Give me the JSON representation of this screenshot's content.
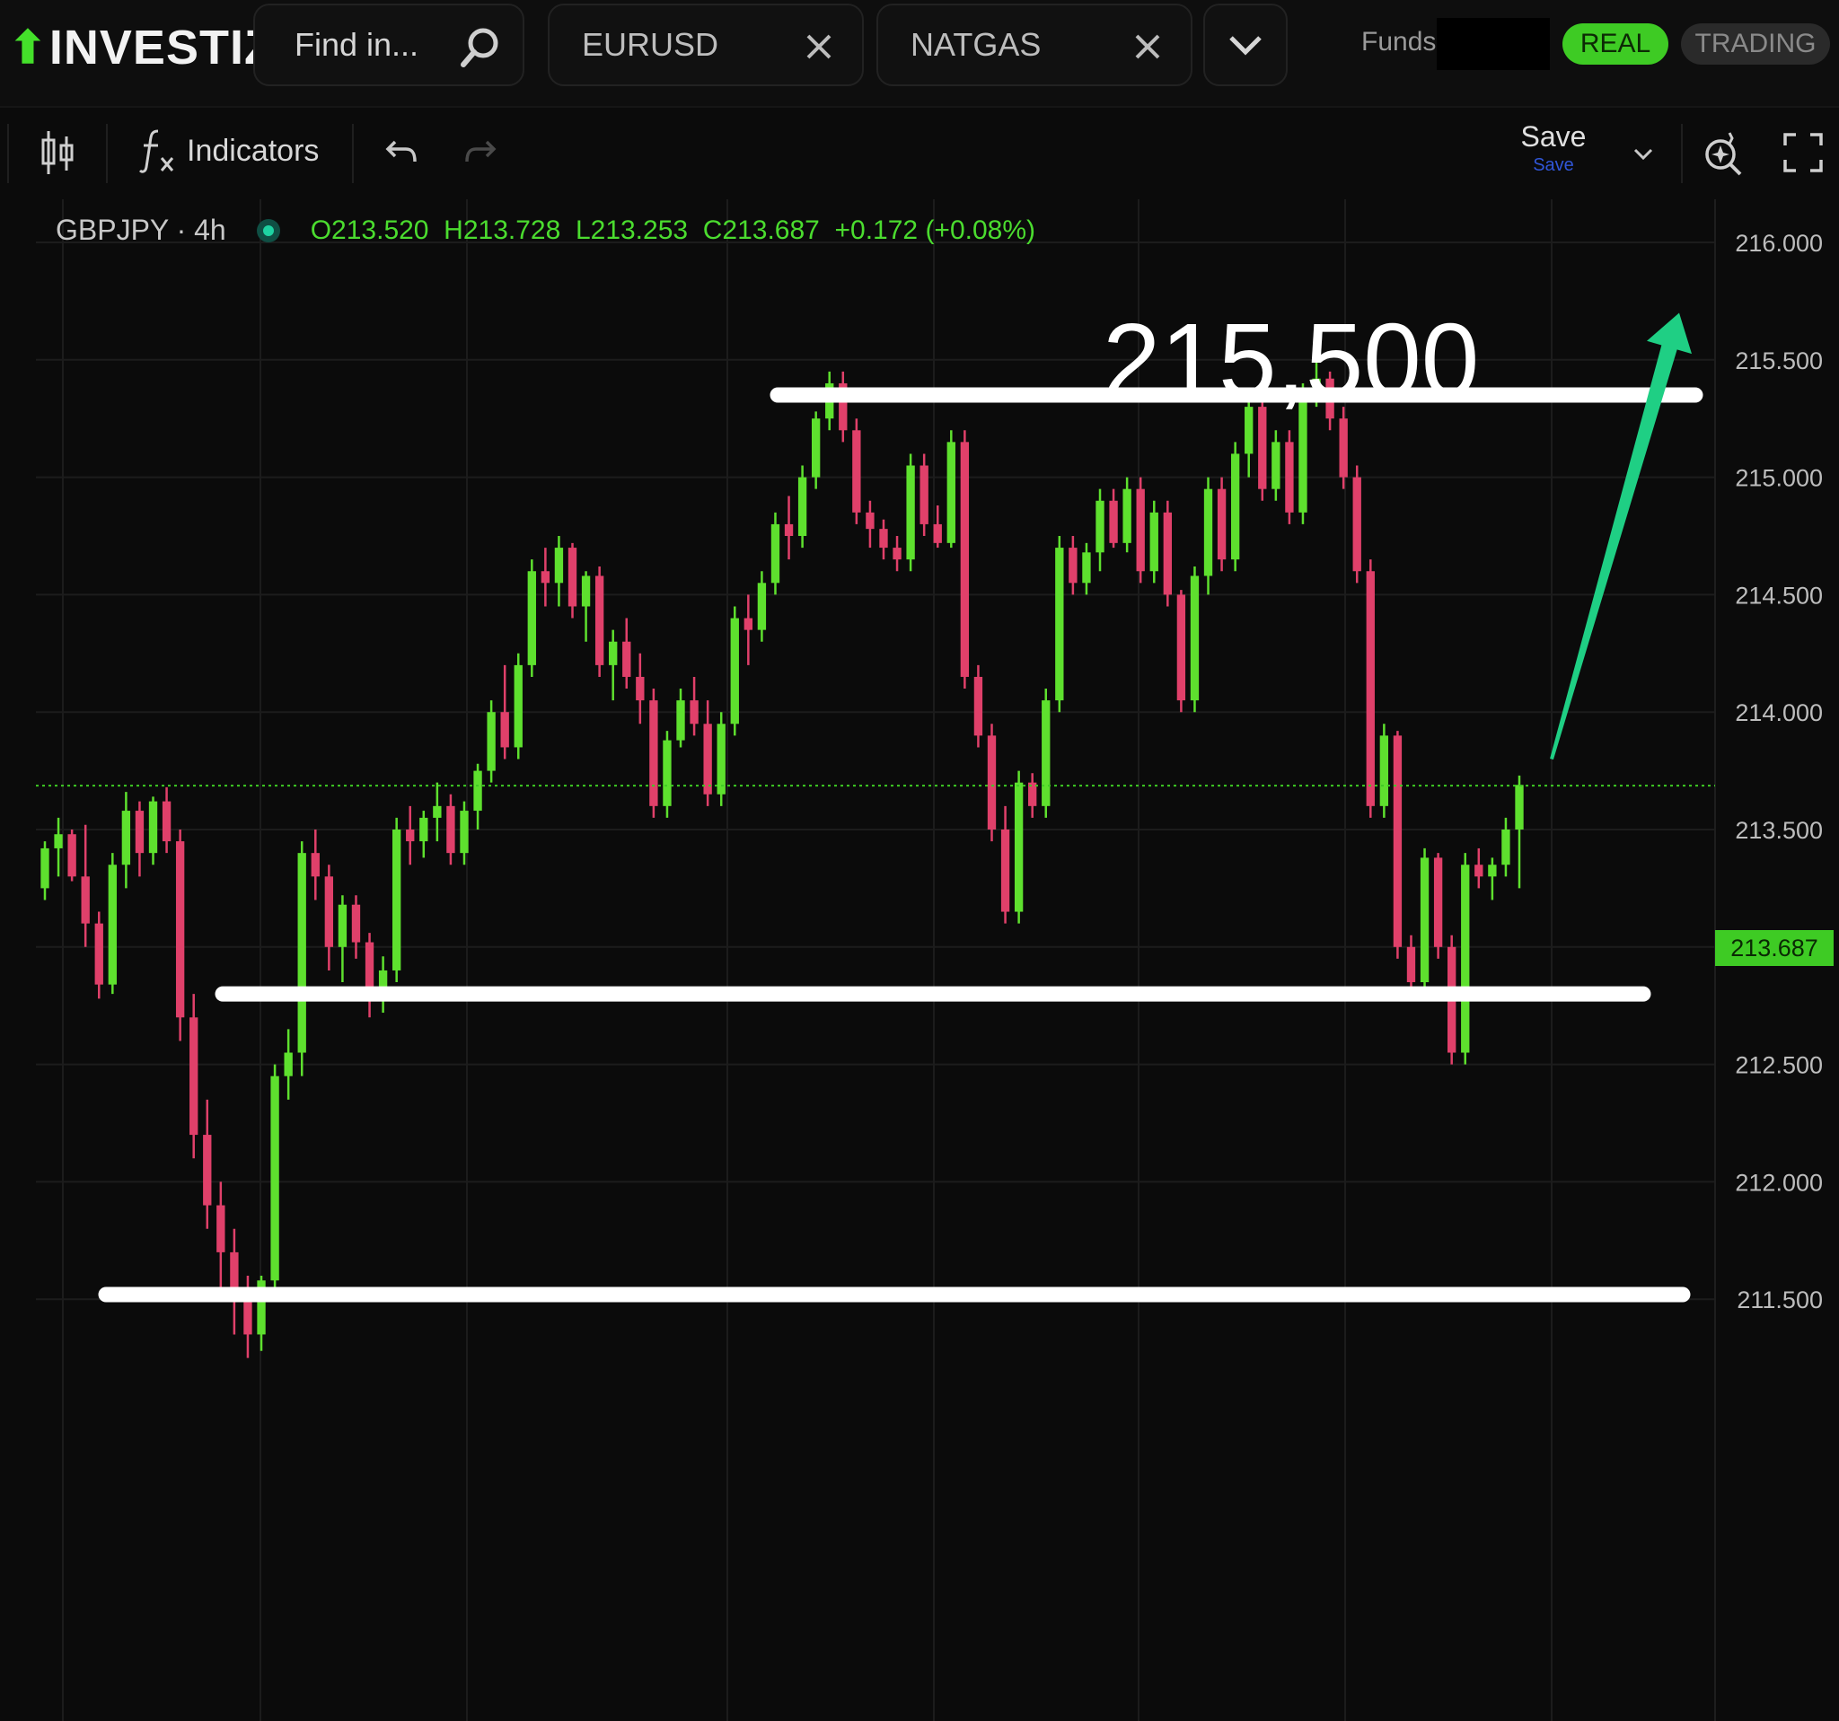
{
  "app": {
    "logo_text": "INVESTIZO"
  },
  "header": {
    "search_placeholder": "Find in...",
    "tabs": [
      {
        "label": "EURUSD"
      },
      {
        "label": "NATGAS"
      }
    ],
    "funds_label": "Funds:",
    "real_label": "REAL",
    "trading_label": "TRADING"
  },
  "toolbar": {
    "indicators_label": "Indicators",
    "save_label": "Save",
    "save_sublabel": "Save"
  },
  "chart_data": {
    "type": "candlestick",
    "symbol": "GBPJPY",
    "interval": "4h",
    "symbol_line": "GBPJPY · 4h",
    "ohlc_text": "O213.520  H213.728  L213.253  C213.687  +0.172 (+0.08%)",
    "last_price": 213.687,
    "last_price_label": "213.687",
    "ylim": [
      211.2,
      216.15
    ],
    "y_ticks": [
      216.0,
      215.5,
      215.0,
      214.5,
      214.0,
      213.5,
      213.0,
      212.5,
      212.0,
      211.5
    ],
    "y_tick_labels": [
      "216.000",
      "215.500",
      "215.000",
      "214.500",
      "214.000",
      "213.500",
      "213.000",
      "212.500",
      "212.000",
      "211.500"
    ],
    "annotation_text": "215,500",
    "horizontal_lines": [
      215.35,
      212.8,
      211.52
    ],
    "arrow": {
      "from_price": 213.8,
      "to_price": 215.7
    },
    "colors": {
      "up": "#5ee02e",
      "down": "#e0406a",
      "background": "#0b0b0b",
      "grid": "#1c1c1c",
      "arrow": "#1fcf84"
    },
    "candles": [
      [
        213.25,
        213.45,
        213.2,
        213.42
      ],
      [
        213.42,
        213.55,
        213.3,
        213.48
      ],
      [
        213.48,
        213.5,
        213.28,
        213.3
      ],
      [
        213.3,
        213.52,
        213.0,
        213.1
      ],
      [
        213.1,
        213.15,
        212.78,
        212.84
      ],
      [
        212.84,
        213.4,
        212.8,
        213.35
      ],
      [
        213.35,
        213.66,
        213.25,
        213.58
      ],
      [
        213.58,
        213.62,
        213.3,
        213.4
      ],
      [
        213.4,
        213.64,
        213.35,
        213.62
      ],
      [
        213.62,
        213.68,
        213.4,
        213.45
      ],
      [
        213.45,
        213.5,
        212.6,
        212.7
      ],
      [
        212.7,
        212.8,
        212.1,
        212.2
      ],
      [
        212.2,
        212.35,
        211.8,
        211.9
      ],
      [
        211.9,
        212.0,
        211.55,
        211.7
      ],
      [
        211.7,
        211.8,
        211.35,
        211.52
      ],
      [
        211.52,
        211.6,
        211.25,
        211.35
      ],
      [
        211.35,
        211.6,
        211.28,
        211.58
      ],
      [
        211.58,
        212.5,
        211.5,
        212.45
      ],
      [
        212.45,
        212.65,
        212.35,
        212.55
      ],
      [
        212.55,
        213.45,
        212.45,
        213.4
      ],
      [
        213.4,
        213.5,
        213.2,
        213.3
      ],
      [
        213.3,
        213.35,
        212.9,
        213.0
      ],
      [
        213.0,
        213.22,
        212.85,
        213.18
      ],
      [
        213.18,
        213.22,
        212.95,
        213.02
      ],
      [
        213.02,
        213.06,
        212.7,
        212.82
      ],
      [
        212.82,
        212.96,
        212.72,
        212.9
      ],
      [
        212.9,
        213.55,
        212.85,
        213.5
      ],
      [
        213.5,
        213.6,
        213.35,
        213.45
      ],
      [
        213.45,
        213.58,
        213.38,
        213.55
      ],
      [
        213.55,
        213.7,
        213.45,
        213.6
      ],
      [
        213.6,
        213.65,
        213.35,
        213.4
      ],
      [
        213.4,
        213.62,
        213.35,
        213.58
      ],
      [
        213.58,
        213.78,
        213.5,
        213.75
      ],
      [
        213.75,
        214.05,
        213.7,
        214.0
      ],
      [
        214.0,
        214.2,
        213.8,
        213.85
      ],
      [
        213.85,
        214.25,
        213.8,
        214.2
      ],
      [
        214.2,
        214.65,
        214.15,
        214.6
      ],
      [
        214.6,
        214.7,
        214.45,
        214.55
      ],
      [
        214.55,
        214.75,
        214.45,
        214.7
      ],
      [
        214.7,
        214.72,
        214.4,
        214.45
      ],
      [
        214.45,
        214.6,
        214.3,
        214.58
      ],
      [
        214.58,
        214.62,
        214.15,
        214.2
      ],
      [
        214.2,
        214.35,
        214.05,
        214.3
      ],
      [
        214.3,
        214.4,
        214.1,
        214.15
      ],
      [
        214.15,
        214.25,
        213.95,
        214.05
      ],
      [
        214.05,
        214.1,
        213.55,
        213.6
      ],
      [
        213.6,
        213.92,
        213.55,
        213.88
      ],
      [
        213.88,
        214.1,
        213.85,
        214.05
      ],
      [
        214.05,
        214.15,
        213.9,
        213.95
      ],
      [
        213.95,
        214.05,
        213.6,
        213.65
      ],
      [
        213.65,
        214.0,
        213.6,
        213.95
      ],
      [
        213.95,
        214.45,
        213.9,
        214.4
      ],
      [
        214.4,
        214.5,
        214.2,
        214.35
      ],
      [
        214.35,
        214.6,
        214.3,
        214.55
      ],
      [
        214.55,
        214.85,
        214.5,
        214.8
      ],
      [
        214.8,
        214.92,
        214.65,
        214.75
      ],
      [
        214.75,
        215.05,
        214.7,
        215.0
      ],
      [
        215.0,
        215.28,
        214.95,
        215.25
      ],
      [
        215.25,
        215.45,
        215.2,
        215.4
      ],
      [
        215.4,
        215.45,
        215.15,
        215.2
      ],
      [
        215.2,
        215.25,
        214.8,
        214.85
      ],
      [
        214.85,
        214.9,
        214.7,
        214.78
      ],
      [
        214.78,
        214.82,
        214.65,
        214.7
      ],
      [
        214.7,
        214.75,
        214.6,
        214.65
      ],
      [
        214.65,
        215.1,
        214.6,
        215.05
      ],
      [
        215.05,
        215.1,
        214.75,
        214.8
      ],
      [
        214.8,
        214.88,
        214.7,
        214.72
      ],
      [
        214.72,
        215.2,
        214.7,
        215.15
      ],
      [
        215.15,
        215.2,
        214.1,
        214.15
      ],
      [
        214.15,
        214.2,
        213.85,
        213.9
      ],
      [
        213.9,
        213.95,
        213.45,
        213.5
      ],
      [
        213.5,
        213.6,
        213.1,
        213.15
      ],
      [
        213.15,
        213.75,
        213.1,
        213.7
      ],
      [
        213.7,
        213.74,
        213.55,
        213.6
      ],
      [
        213.6,
        214.1,
        213.55,
        214.05
      ],
      [
        214.05,
        214.75,
        214.0,
        214.7
      ],
      [
        214.7,
        214.75,
        214.5,
        214.55
      ],
      [
        214.55,
        214.72,
        214.5,
        214.68
      ],
      [
        214.68,
        214.95,
        214.6,
        214.9
      ],
      [
        214.9,
        214.95,
        214.7,
        214.72
      ],
      [
        214.72,
        215.0,
        214.68,
        214.95
      ],
      [
        214.95,
        215.0,
        214.55,
        214.6
      ],
      [
        214.6,
        214.9,
        214.55,
        214.85
      ],
      [
        214.85,
        214.9,
        214.45,
        214.5
      ],
      [
        214.5,
        214.52,
        214.0,
        214.05
      ],
      [
        214.05,
        214.62,
        214.0,
        214.58
      ],
      [
        214.58,
        215.0,
        214.5,
        214.95
      ],
      [
        214.95,
        215.0,
        214.6,
        214.65
      ],
      [
        214.65,
        215.15,
        214.6,
        215.1
      ],
      [
        215.1,
        215.35,
        215.0,
        215.3
      ],
      [
        215.3,
        215.35,
        214.9,
        214.95
      ],
      [
        214.95,
        215.2,
        214.9,
        215.15
      ],
      [
        215.15,
        215.2,
        214.8,
        214.85
      ],
      [
        214.85,
        215.4,
        214.8,
        215.35
      ],
      [
        215.35,
        215.5,
        215.3,
        215.42
      ],
      [
        215.42,
        215.45,
        215.2,
        215.25
      ],
      [
        215.25,
        215.3,
        214.95,
        215.0
      ],
      [
        215.0,
        215.05,
        214.55,
        214.6
      ],
      [
        214.6,
        214.65,
        213.55,
        213.6
      ],
      [
        213.6,
        213.95,
        213.55,
        213.9
      ],
      [
        213.9,
        213.92,
        212.95,
        213.0
      ],
      [
        213.0,
        213.05,
        212.8,
        212.85
      ],
      [
        212.85,
        213.42,
        212.8,
        213.38
      ],
      [
        213.38,
        213.4,
        212.95,
        213.0
      ],
      [
        213.0,
        213.05,
        212.5,
        212.55
      ],
      [
        212.55,
        213.4,
        212.5,
        213.35
      ],
      [
        213.35,
        213.42,
        213.25,
        213.3
      ],
      [
        213.3,
        213.38,
        213.2,
        213.35
      ],
      [
        213.35,
        213.55,
        213.3,
        213.5
      ],
      [
        213.5,
        213.73,
        213.25,
        213.69
      ]
    ]
  }
}
